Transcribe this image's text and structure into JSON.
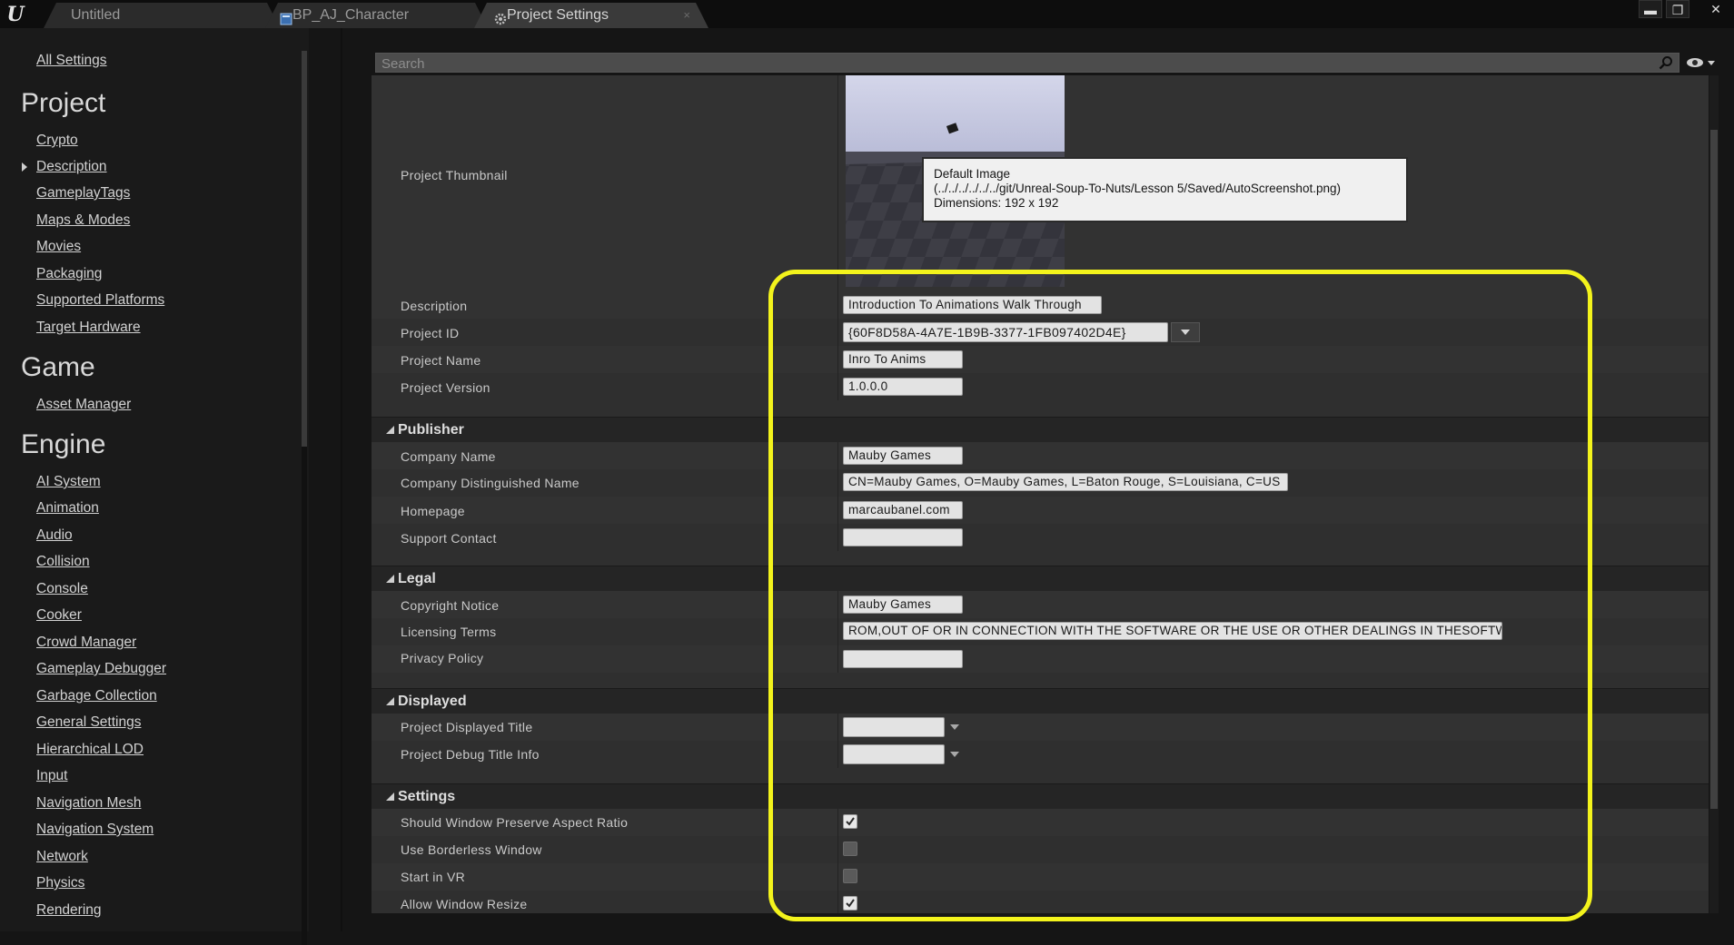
{
  "tabs": [
    {
      "label": "Untitled",
      "icon": "level-icon"
    },
    {
      "label": "BP_AJ_Character",
      "icon": "blueprint-icon"
    },
    {
      "label": "Project Settings",
      "icon": "settings-gear-icon"
    }
  ],
  "window_controls": {
    "minimize": "▬",
    "restore": "❐",
    "close": "✕"
  },
  "sidebar": {
    "all_settings": "All Settings",
    "sections": [
      {
        "title": "Project",
        "items": [
          "Crypto",
          "Description",
          "GameplayTags",
          "Maps & Modes",
          "Movies",
          "Packaging",
          "Supported Platforms",
          "Target Hardware"
        ],
        "selected": "Description"
      },
      {
        "title": "Game",
        "items": [
          "Asset Manager"
        ]
      },
      {
        "title": "Engine",
        "items": [
          "AI System",
          "Animation",
          "Audio",
          "Collision",
          "Console",
          "Cooker",
          "Crowd Manager",
          "Gameplay Debugger",
          "Garbage Collection",
          "General Settings",
          "Hierarchical LOD",
          "Input",
          "Navigation Mesh",
          "Navigation System",
          "Network",
          "Physics",
          "Rendering"
        ]
      }
    ]
  },
  "search": {
    "placeholder": "Search",
    "value": ""
  },
  "details": {
    "thumbnail": {
      "label": "Project Thumbnail",
      "tooltip": {
        "line1": "Default Image",
        "line2": "(../../../../../../git/Unreal-Soup-To-Nuts/Lesson 5/Saved/AutoScreenshot.png)",
        "line3": "Dimensions: 192 x 192"
      }
    },
    "about": {
      "description": {
        "label": "Description",
        "value": "Introduction To Animations Walk Through"
      },
      "project_id": {
        "label": "Project ID",
        "value": "{60F8D58A-4A7E-1B9B-3377-1FB097402D4E}"
      },
      "project_name": {
        "label": "Project Name",
        "value": "Inro To Anims"
      },
      "project_version": {
        "label": "Project Version",
        "value": "1.0.0.0"
      }
    },
    "publisher": {
      "title": "Publisher",
      "company_name": {
        "label": "Company Name",
        "value": "Mauby Games"
      },
      "company_dn": {
        "label": "Company Distinguished Name",
        "value": "CN=Mauby Games, O=Mauby Games, L=Baton Rouge, S=Louisiana, C=US"
      },
      "homepage": {
        "label": "Homepage",
        "value": "marcaubanel.com"
      },
      "support_contact": {
        "label": "Support Contact",
        "value": ""
      }
    },
    "legal": {
      "title": "Legal",
      "copyright": {
        "label": "Copyright Notice",
        "value": "Mauby Games"
      },
      "licensing": {
        "label": "Licensing Terms",
        "value": "ROM,OUT OF OR IN CONNECTION WITH THE SOFTWARE OR THE USE OR OTHER DEALINGS IN THESOFTWARE."
      },
      "privacy": {
        "label": "Privacy Policy",
        "value": ""
      }
    },
    "displayed": {
      "title": "Displayed",
      "displayed_title": {
        "label": "Project Displayed Title",
        "value": ""
      },
      "debug_title": {
        "label": "Project Debug Title Info",
        "value": ""
      }
    },
    "settings": {
      "title": "Settings",
      "preserve_aspect": {
        "label": "Should Window Preserve Aspect Ratio",
        "checked": true
      },
      "borderless": {
        "label": "Use Borderless Window",
        "checked": false
      },
      "start_vr": {
        "label": "Start in VR",
        "checked": false
      },
      "allow_resize": {
        "label": "Allow Window Resize",
        "checked": true
      }
    }
  },
  "colors": {
    "annotation": "#f3f31c",
    "panel": "#2f2f2f",
    "sidebar": "#1a1a1a"
  }
}
